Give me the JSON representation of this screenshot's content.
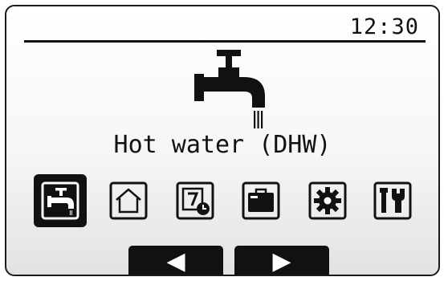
{
  "status_bar": {
    "time": "12:30"
  },
  "main": {
    "title": "Hot water (DHW)",
    "hero_icon": "tap-icon"
  },
  "menu": {
    "items": [
      {
        "name": "hot-water",
        "icon": "tap-icon",
        "selected": true
      },
      {
        "name": "heating",
        "icon": "house-icon",
        "selected": false
      },
      {
        "name": "schedule",
        "icon": "calendar-clock-icon",
        "selected": false
      },
      {
        "name": "holiday",
        "icon": "suitcase-icon",
        "selected": false
      },
      {
        "name": "settings",
        "icon": "gear-icon",
        "selected": false
      },
      {
        "name": "service",
        "icon": "tools-icon",
        "selected": false
      }
    ]
  },
  "nav": {
    "prev_glyph": "◀",
    "next_glyph": "▶"
  }
}
